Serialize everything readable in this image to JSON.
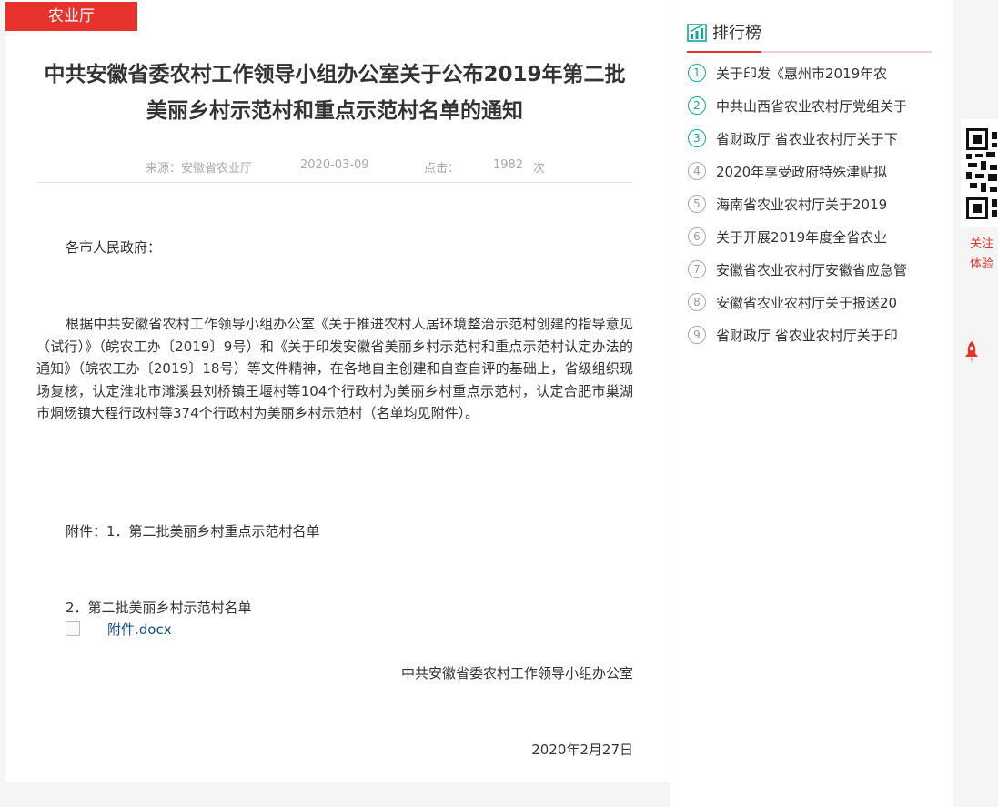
{
  "category": "农业厅",
  "article": {
    "title": "中共安徽省委农村工作领导小组办公室关于公布2019年第二批美丽乡村示范村和重点示范村名单的通知",
    "source": "来源：安徽省农业厅",
    "date": "2020-03-09",
    "clicks_label": "点击：",
    "clicks_count": "1982",
    "clicks_unit": "次",
    "greeting": "各市人民政府：",
    "body": "根据中共安徽省农村工作领导小组办公室《关于推进农村人居环境整治示范村创建的指导意见（试行）》（皖农工办〔2019〕9号）和《关于印发安徽省美丽乡村示范村和重点示范村认定办法的通知》（皖农工办〔2019〕18号）等文件精神，在各地自主创建和自查自评的基础上，省级组织现场复核，认定淮北市濉溪县刘桥镇王堰村等104个行政村为美丽乡村重点示范村，认定合肥市巢湖市烔炀镇大程行政村等374个行政村为美丽乡村示范村（名单均见附件）。",
    "attachment_line1": "附件：1．第二批美丽乡村重点示范村名单",
    "attachment_line2": "2．第二批美丽乡村示范村名单",
    "attachment_link": "附件.docx",
    "signature_org": "中共安徽省委农村工作领导小组办公室",
    "signature_date": "2020年2月27日"
  },
  "sidebar": {
    "title": "排行榜",
    "items": [
      {
        "num": "1",
        "label": "关于印发《惠州市2019年农"
      },
      {
        "num": "2",
        "label": "中共山西省农业农村厅党组关于"
      },
      {
        "num": "3",
        "label": "省财政厅 省农业农村厅关于下"
      },
      {
        "num": "4",
        "label": "2020年享受政府特殊津贴拟"
      },
      {
        "num": "5",
        "label": "海南省农业农村厅关于2019"
      },
      {
        "num": "6",
        "label": "关于开展2019年度全省农业"
      },
      {
        "num": "7",
        "label": "安徽省农业农村厅安徽省应急管"
      },
      {
        "num": "8",
        "label": "安徽省农业农村厅关于报送20"
      },
      {
        "num": "9",
        "label": "省财政厅 省农业农村厅关于印"
      }
    ]
  },
  "float_panel": {
    "caption_line1": "关注",
    "caption_line2": "体验"
  },
  "colors": {
    "accent": "#e8322e",
    "teal": "#12a69a",
    "link": "#1a4e96"
  },
  "icons": [
    "bar-chart-icon",
    "qr-code-icon",
    "rocket-icon",
    "image-placeholder-icon"
  ]
}
